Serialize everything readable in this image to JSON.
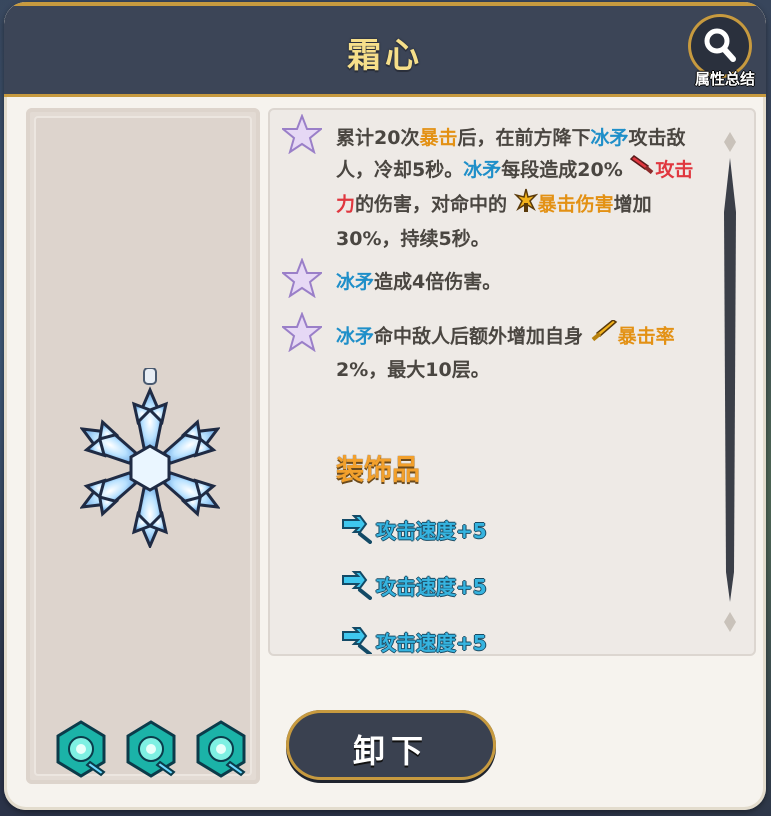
{
  "header": {
    "title": "霜心",
    "summary_label": "属性总结",
    "search_icon": "magnifier-icon"
  },
  "description": {
    "entries": [
      {
        "parts": [
          {
            "text": "累计20次",
            "style": "normal"
          },
          {
            "text": "暴击",
            "style": "orange"
          },
          {
            "text": "后，在前方降下",
            "style": "normal"
          },
          {
            "text": "冰矛",
            "style": "blue"
          },
          {
            "text": "攻击敌人，冷却5秒。",
            "style": "normal"
          },
          {
            "text": "冰矛",
            "style": "blue"
          },
          {
            "text": "每段造成20% ",
            "style": "normal"
          },
          {
            "icon": "sword-red-icon"
          },
          {
            "text": "攻击力",
            "style": "red"
          },
          {
            "text": "的伤害，对命中的 ",
            "style": "normal"
          },
          {
            "icon": "crit-damage-icon"
          },
          {
            "text": "暴击伤害",
            "style": "orange"
          },
          {
            "text": "增加30%，持续5秒。",
            "style": "normal"
          }
        ]
      },
      {
        "parts": [
          {
            "text": "冰矛",
            "style": "blue"
          },
          {
            "text": "造成4倍伤害。",
            "style": "normal"
          }
        ]
      },
      {
        "parts": [
          {
            "text": "冰矛",
            "style": "blue"
          },
          {
            "text": "命中敌人后额外增加自身 ",
            "style": "normal"
          },
          {
            "icon": "sword-gold-icon"
          },
          {
            "text": "暴击率",
            "style": "orange"
          },
          {
            "text": "2%，最大10层。",
            "style": "normal"
          }
        ]
      }
    ],
    "section_title": "装饰品",
    "stats": [
      {
        "label": "攻击速度+5",
        "icon": "attack-speed-icon"
      },
      {
        "label": "攻击速度+5",
        "icon": "attack-speed-icon"
      },
      {
        "label": "攻击速度+5",
        "icon": "attack-speed-icon"
      }
    ]
  },
  "item": {
    "image_icon": "snowflake-pendant-icon",
    "gems": [
      "teal-gem-icon",
      "teal-gem-icon",
      "teal-gem-icon"
    ]
  },
  "button": {
    "unequip_label": "卸下"
  },
  "colors": {
    "header_bg": "#3c4557",
    "gold": "#c79a3f",
    "title": "#f6df8a",
    "keyword_blue": "#1f8fc9",
    "keyword_orange": "#e39114",
    "keyword_red": "#e0373f",
    "section_title": "#f2a02c",
    "stat_text": "#36b4e0"
  }
}
